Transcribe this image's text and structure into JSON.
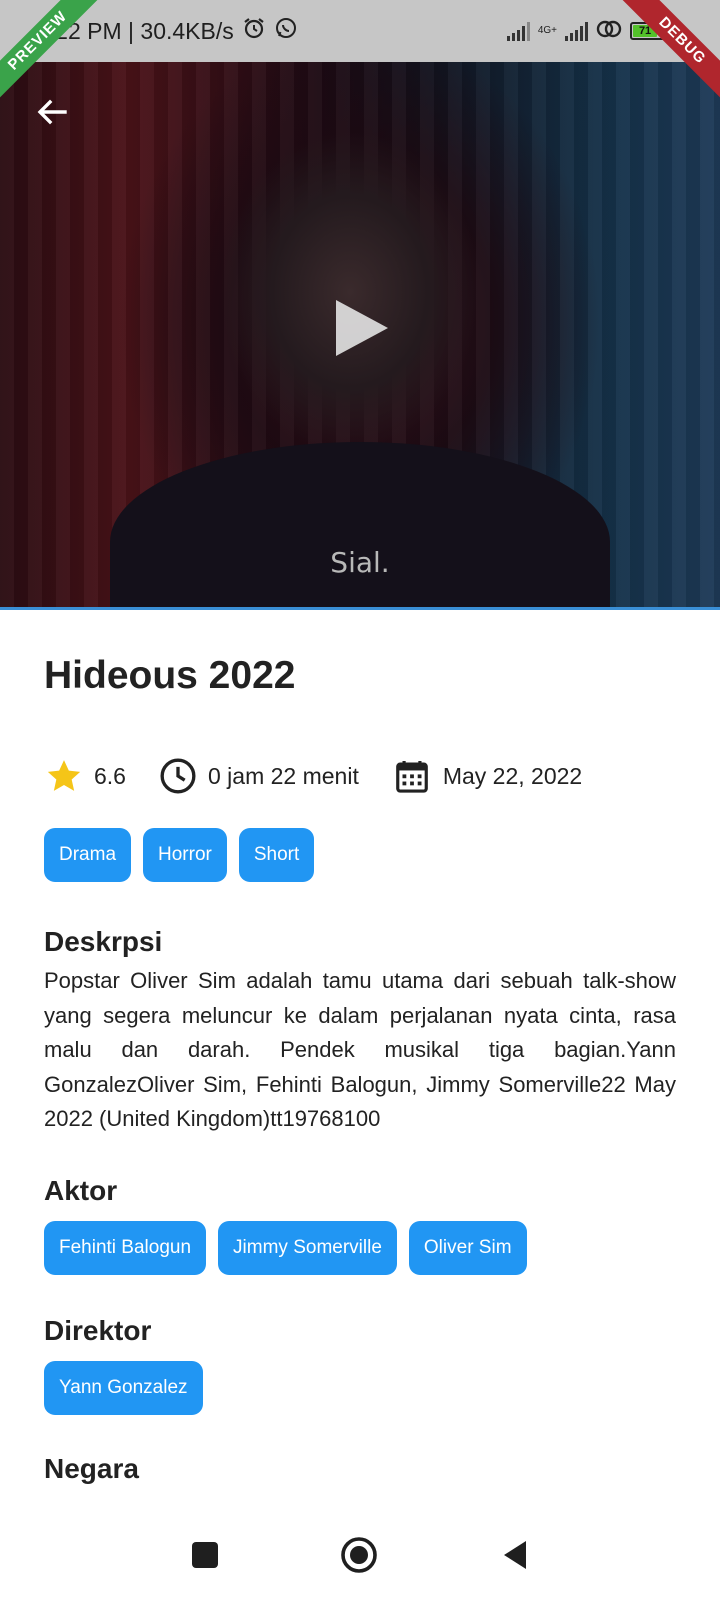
{
  "status_bar": {
    "time_speed": "2:22 PM | 30.4KB/s",
    "network_type": "4G+",
    "battery_level": "71"
  },
  "banners": {
    "left": "PREVIEW",
    "right": "DEBUG"
  },
  "video": {
    "subtitle": "Sial."
  },
  "movie": {
    "title": "Hideous 2022",
    "rating": "6.6",
    "duration": "0 jam 22 menit",
    "release_date": "May 22, 2022",
    "genres": [
      "Drama",
      "Horror",
      "Short"
    ],
    "description_heading": "Deskrpsi",
    "description": "Popstar Oliver Sim adalah tamu utama dari sebuah talk-show yang segera meluncur ke dalam perjalanan nyata cinta, rasa malu dan darah. Pendek musikal tiga bagian.Yann GonzalezOliver Sim, Fehinti Balogun, Jimmy Somerville22 May 2022 (United Kingdom)tt19768100",
    "actors_heading": "Aktor",
    "actors": [
      "Fehinti Balogun",
      "Jimmy Somerville",
      "Oliver Sim"
    ],
    "director_heading": "Direktor",
    "directors": [
      "Yann Gonzalez"
    ],
    "country_heading": "Negara"
  },
  "colors": {
    "accent": "#2196f3",
    "star": "#f5c518",
    "status_bar": "#c6c6c6"
  },
  "icons": {
    "back": "arrow-back-icon",
    "play": "play-icon",
    "rating": "star-icon",
    "duration": "clock-icon",
    "date": "calendar-icon",
    "nav_recents": "square-icon",
    "nav_home": "circle-icon",
    "nav_back": "triangle-back-icon"
  }
}
